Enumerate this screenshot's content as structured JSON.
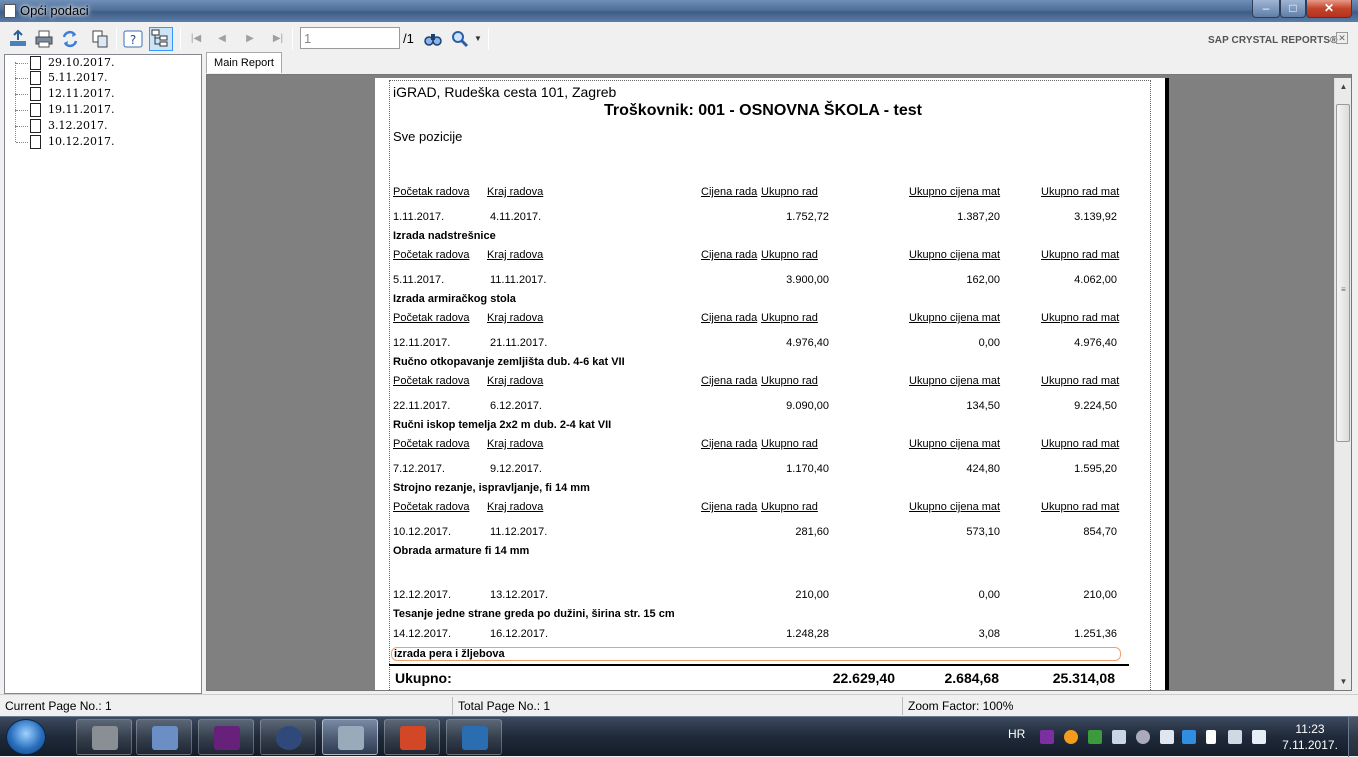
{
  "window": {
    "title": "Opći podaci"
  },
  "toolbar": {
    "page_value": "1",
    "page_total": "/1",
    "brand": "SAP CRYSTAL REPORTS®"
  },
  "tree": {
    "items": [
      "29.10.2017.",
      "5.11.2017.",
      "12.11.2017.",
      "19.11.2017.",
      "3.12.2017.",
      "10.12.2017."
    ]
  },
  "tab": {
    "label": "Main Report"
  },
  "report": {
    "company": "iGRAD, Rudeška cesta 101, Zagreb",
    "title": "Troškovnik: 001 - OSNOVNA ŠKOLA - test",
    "subtitle": "Sve pozicije",
    "headers": {
      "start": "Početak radova",
      "end": "Kraj radova",
      "price": "Cijena rada",
      "total_work": "Ukupno rad",
      "total_mat": "Ukupno cijena mat",
      "total_work_mat": "Ukupno rad mat"
    },
    "rows": [
      {
        "start": "1.11.2017.",
        "end": "4.11.2017.",
        "total_work": "1.752,72",
        "total_mat": "1.387,20",
        "total_work_mat": "3.139,92",
        "desc": "Izrada nadstrešnice"
      },
      {
        "start": "5.11.2017.",
        "end": "11.11.2017.",
        "total_work": "3.900,00",
        "total_mat": "162,00",
        "total_work_mat": "4.062,00",
        "desc": "Izrada armiračkog stola"
      },
      {
        "start": "12.11.2017.",
        "end": "21.11.2017.",
        "total_work": "4.976,40",
        "total_mat": "0,00",
        "total_work_mat": "4.976,40",
        "desc": "Ručno otkopavanje zemljišta dub. 4-6 kat VII"
      },
      {
        "start": "22.11.2017.",
        "end": "6.12.2017.",
        "total_work": "9.090,00",
        "total_mat": "134,50",
        "total_work_mat": "9.224,50",
        "desc": "Ručni iskop temelja 2x2 m dub. 2-4 kat VII"
      },
      {
        "start": "7.12.2017.",
        "end": "9.12.2017.",
        "total_work": "1.170,40",
        "total_mat": "424,80",
        "total_work_mat": "1.595,20",
        "desc": "Strojno rezanje, ispravljanje, fi 14 mm"
      },
      {
        "start": "10.12.2017.",
        "end": "11.12.2017.",
        "total_work": "281,60",
        "total_mat": "573,10",
        "total_work_mat": "854,70",
        "desc": "Obrada armature fi 14 mm"
      },
      {
        "start": "12.12.2017.",
        "end": "13.12.2017.",
        "total_work": "210,00",
        "total_mat": "0,00",
        "total_work_mat": "210,00",
        "desc": "Tesanje jedne strane greda po dužini, širina str. 15 cm"
      },
      {
        "start": "14.12.2017.",
        "end": "16.12.2017.",
        "total_work": "1.248,28",
        "total_mat": "3,08",
        "total_work_mat": "1.251,36",
        "desc": "izrada pera i žljebova"
      }
    ],
    "totals": {
      "label": "Ukupno:",
      "total_work": "22.629,40",
      "total_mat": "2.684,68",
      "total_work_mat": "25.314,08"
    }
  },
  "status": {
    "current_page": "Current Page No.: 1",
    "total_page": "Total Page No.: 1",
    "zoom": "Zoom Factor: 100%"
  },
  "taskbar": {
    "lang": "HR",
    "time": "11:23",
    "date": "7.11.2017."
  }
}
